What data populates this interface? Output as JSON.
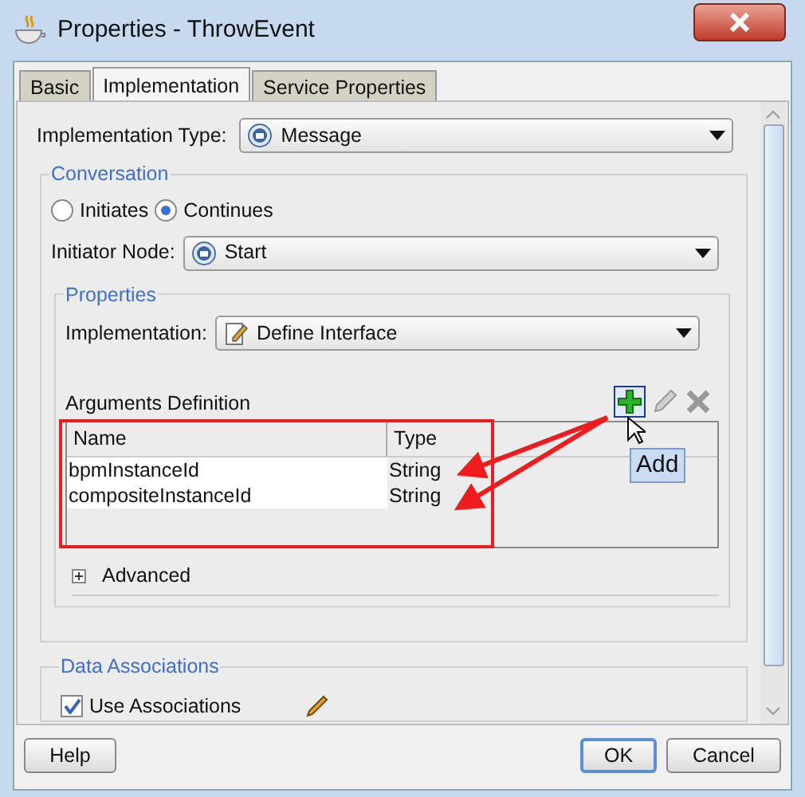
{
  "window": {
    "title": "Properties - ThrowEvent"
  },
  "tabs": [
    {
      "label": "Basic",
      "selected": false
    },
    {
      "label": "Implementation",
      "selected": true
    },
    {
      "label": "Service Properties",
      "selected": false
    }
  ],
  "implementation_type": {
    "label": "Implementation Type:",
    "value": "Message"
  },
  "conversation": {
    "title": "Conversation",
    "options": [
      {
        "label": "Initiates",
        "selected": false
      },
      {
        "label": "Continues",
        "selected": true
      }
    ],
    "initiator_node": {
      "label": "Initiator Node:",
      "value": "Start"
    }
  },
  "properties": {
    "title": "Properties",
    "implementation": {
      "label": "Implementation:",
      "value": "Define Interface"
    },
    "arguments": {
      "title": "Arguments Definition",
      "columns": [
        "Name",
        "Type"
      ],
      "rows": [
        [
          "bpmInstanceId",
          "String"
        ],
        [
          "compositeInstanceId",
          "String"
        ]
      ]
    },
    "advanced": {
      "label": "Advanced",
      "expanded": false
    },
    "tooltip": "Add"
  },
  "data_associations": {
    "title": "Data Associations",
    "use_associations": {
      "label": "Use Associations",
      "checked": true
    }
  },
  "buttons": [
    {
      "label": "Help",
      "default": false
    },
    {
      "label": "OK",
      "default": true
    },
    {
      "label": "Cancel",
      "default": false
    }
  ]
}
